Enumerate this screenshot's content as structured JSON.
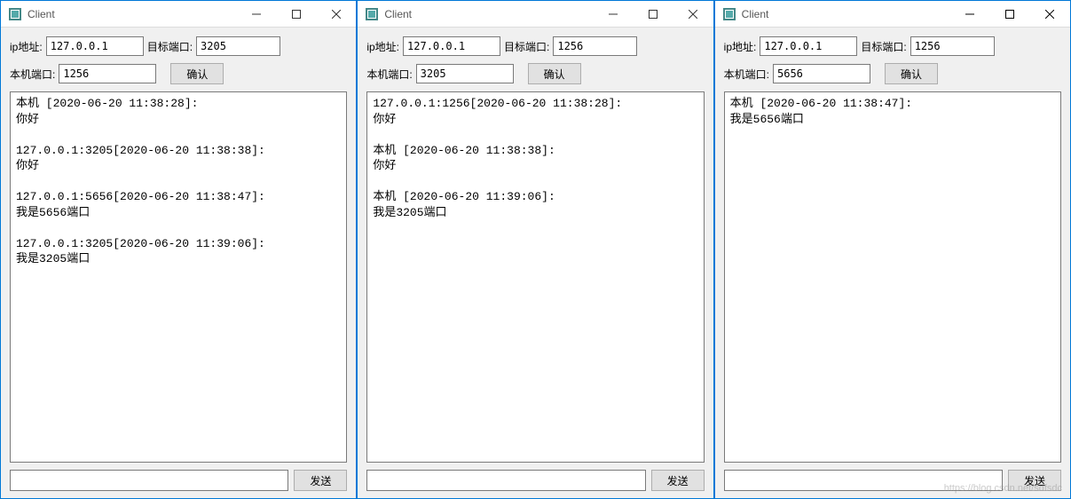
{
  "windows": [
    {
      "title": "Client",
      "ip_label": "ip地址:",
      "ip_value": "127.0.0.1",
      "target_port_label": "目标端口:",
      "target_port_value": "3205",
      "local_port_label": "本机端口:",
      "local_port_value": "1256",
      "confirm_label": "确认",
      "log_text": "本机 [2020-06-20 11:38:28]:\n你好\n\n127.0.0.1:3205[2020-06-20 11:38:38]:\n你好\n\n127.0.0.1:5656[2020-06-20 11:38:47]:\n我是5656端口\n\n127.0.0.1:3205[2020-06-20 11:39:06]:\n我是3205端口",
      "send_value": "",
      "send_label": "发送"
    },
    {
      "title": "Client",
      "ip_label": "ip地址:",
      "ip_value": "127.0.0.1",
      "target_port_label": "目标端口:",
      "target_port_value": "1256",
      "local_port_label": "本机端口:",
      "local_port_value": "3205",
      "confirm_label": "确认",
      "log_text": "127.0.0.1:1256[2020-06-20 11:38:28]:\n你好\n\n本机 [2020-06-20 11:38:38]:\n你好\n\n本机 [2020-06-20 11:39:06]:\n我是3205端口",
      "send_value": "",
      "send_label": "发送"
    },
    {
      "title": "Client",
      "ip_label": "ip地址:",
      "ip_value": "127.0.0.1",
      "target_port_label": "目标端口:",
      "target_port_value": "1256",
      "local_port_label": "本机端口:",
      "local_port_value": "5656",
      "confirm_label": "确认",
      "log_text": "本机 [2020-06-20 11:38:47]:\n我是5656端口",
      "send_value": "",
      "send_label": "发送"
    }
  ],
  "watermark": "https://blog.csdn.net/sdfsdc"
}
